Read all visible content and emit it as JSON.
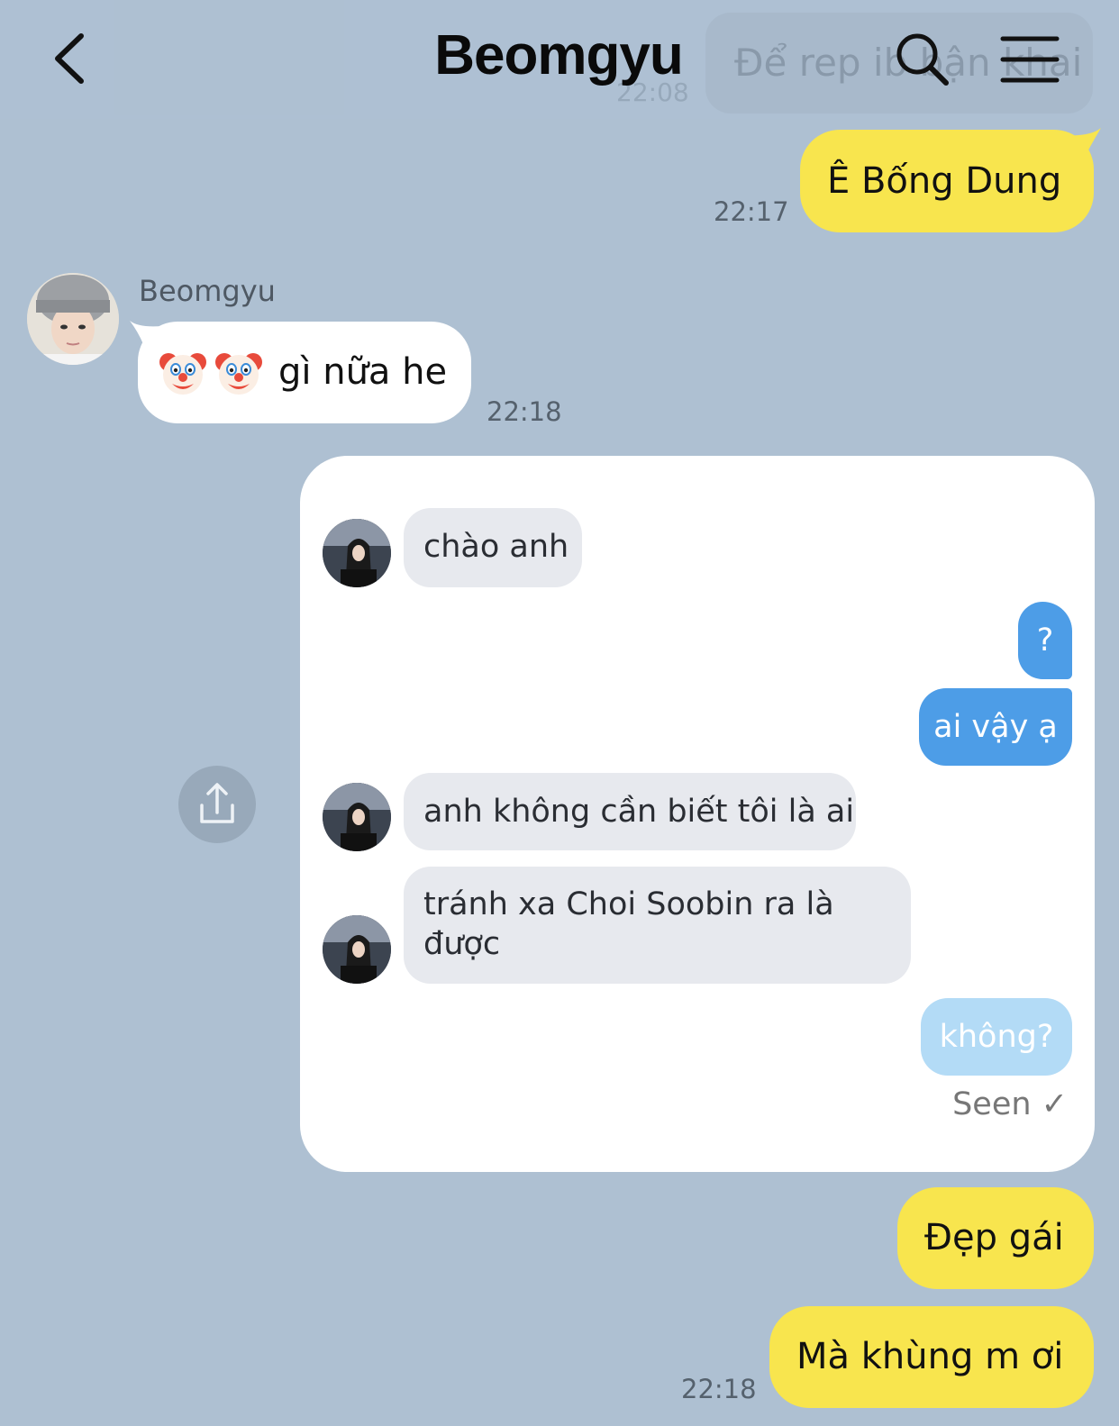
{
  "header": {
    "title": "Beomgyu",
    "pinned_preview": "Để rep ib bận khai",
    "pinned_time": "22:08"
  },
  "messages": {
    "msg1": {
      "text": "Ê Bống Dung",
      "time": "22:17"
    },
    "msg2": {
      "sender": "Beomgyu",
      "text": "gì nữa he",
      "emoji": "clown-face",
      "time": "22:18"
    },
    "msg3": {
      "text": "Đẹp gái"
    },
    "msg4": {
      "text": "Mà khùng m ơi",
      "time": "22:18"
    }
  },
  "screenshot": {
    "m1": "chào anh",
    "m2": "?",
    "m3": "ai vậy ạ",
    "m4": "anh không cần biết tôi là ai",
    "m5_line1": "tránh xa Choi Soobin ra là",
    "m5_line2": "được",
    "m6": "không?",
    "seen": "Seen ✓"
  },
  "colors": {
    "background": "#aec0d2",
    "my_bubble": "#f8e54e",
    "their_bubble": "#ffffff",
    "card_sent": "#4d9de7",
    "card_received": "#e7e9ee"
  },
  "icons": [
    "back-chevron-icon",
    "search-icon",
    "menu-icon",
    "share-icon",
    "clown-face-icon"
  ]
}
